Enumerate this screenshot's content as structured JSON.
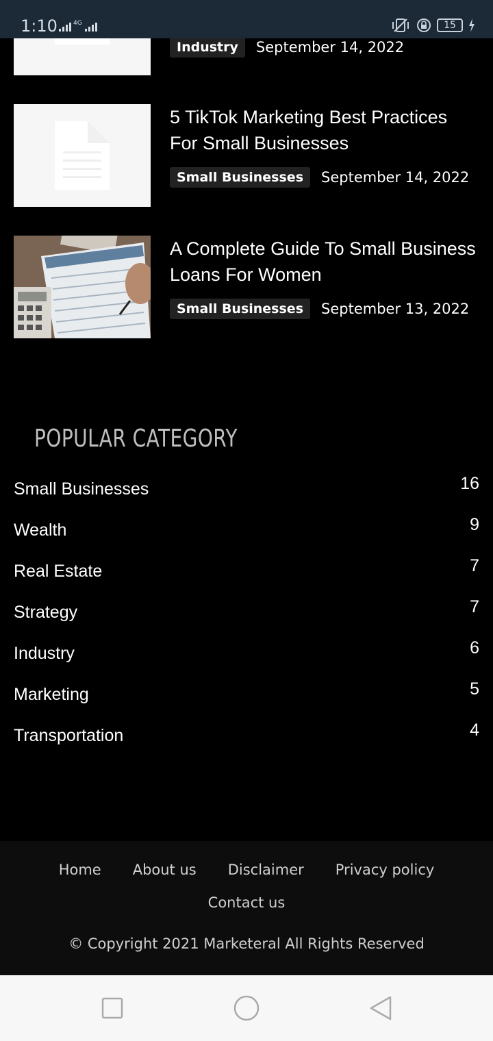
{
  "status_bar": {
    "time": "1:10",
    "network": "4G",
    "battery": "15"
  },
  "articles": [
    {
      "title": "",
      "category": "Industry",
      "date": "September 14, 2022",
      "thumbnail": "document-placeholder"
    },
    {
      "title": "5 TikTok Marketing Best Practices For Small Businesses",
      "category": "Small Businesses",
      "date": "September 14, 2022",
      "thumbnail": "document-placeholder"
    },
    {
      "title": "A Complete Guide To Small Business Loans For Women",
      "category": "Small Businesses",
      "date": "September 13, 2022",
      "thumbnail": "loan-form-photo"
    }
  ],
  "popular_category": {
    "heading": "POPULAR CATEGORY",
    "items": [
      {
        "name": "Small Businesses",
        "count": "16"
      },
      {
        "name": "Wealth",
        "count": "9"
      },
      {
        "name": "Real Estate",
        "count": "7"
      },
      {
        "name": "Strategy",
        "count": "7"
      },
      {
        "name": "Industry",
        "count": "6"
      },
      {
        "name": "Marketing",
        "count": "5"
      },
      {
        "name": "Transportation",
        "count": "4"
      }
    ]
  },
  "footer": {
    "links": [
      "Home",
      "About us",
      "Disclaimer",
      "Privacy policy",
      "Contact us"
    ],
    "copyright": "© Copyright 2021 Marketeral All Rights Reserved"
  },
  "colors": {
    "background": "#000000",
    "status_bar": "#1c2a38",
    "badge": "#222222",
    "heading": "#bfbfbf",
    "footer": "#0d0d0d",
    "nav_bar": "#f7f7f7"
  }
}
